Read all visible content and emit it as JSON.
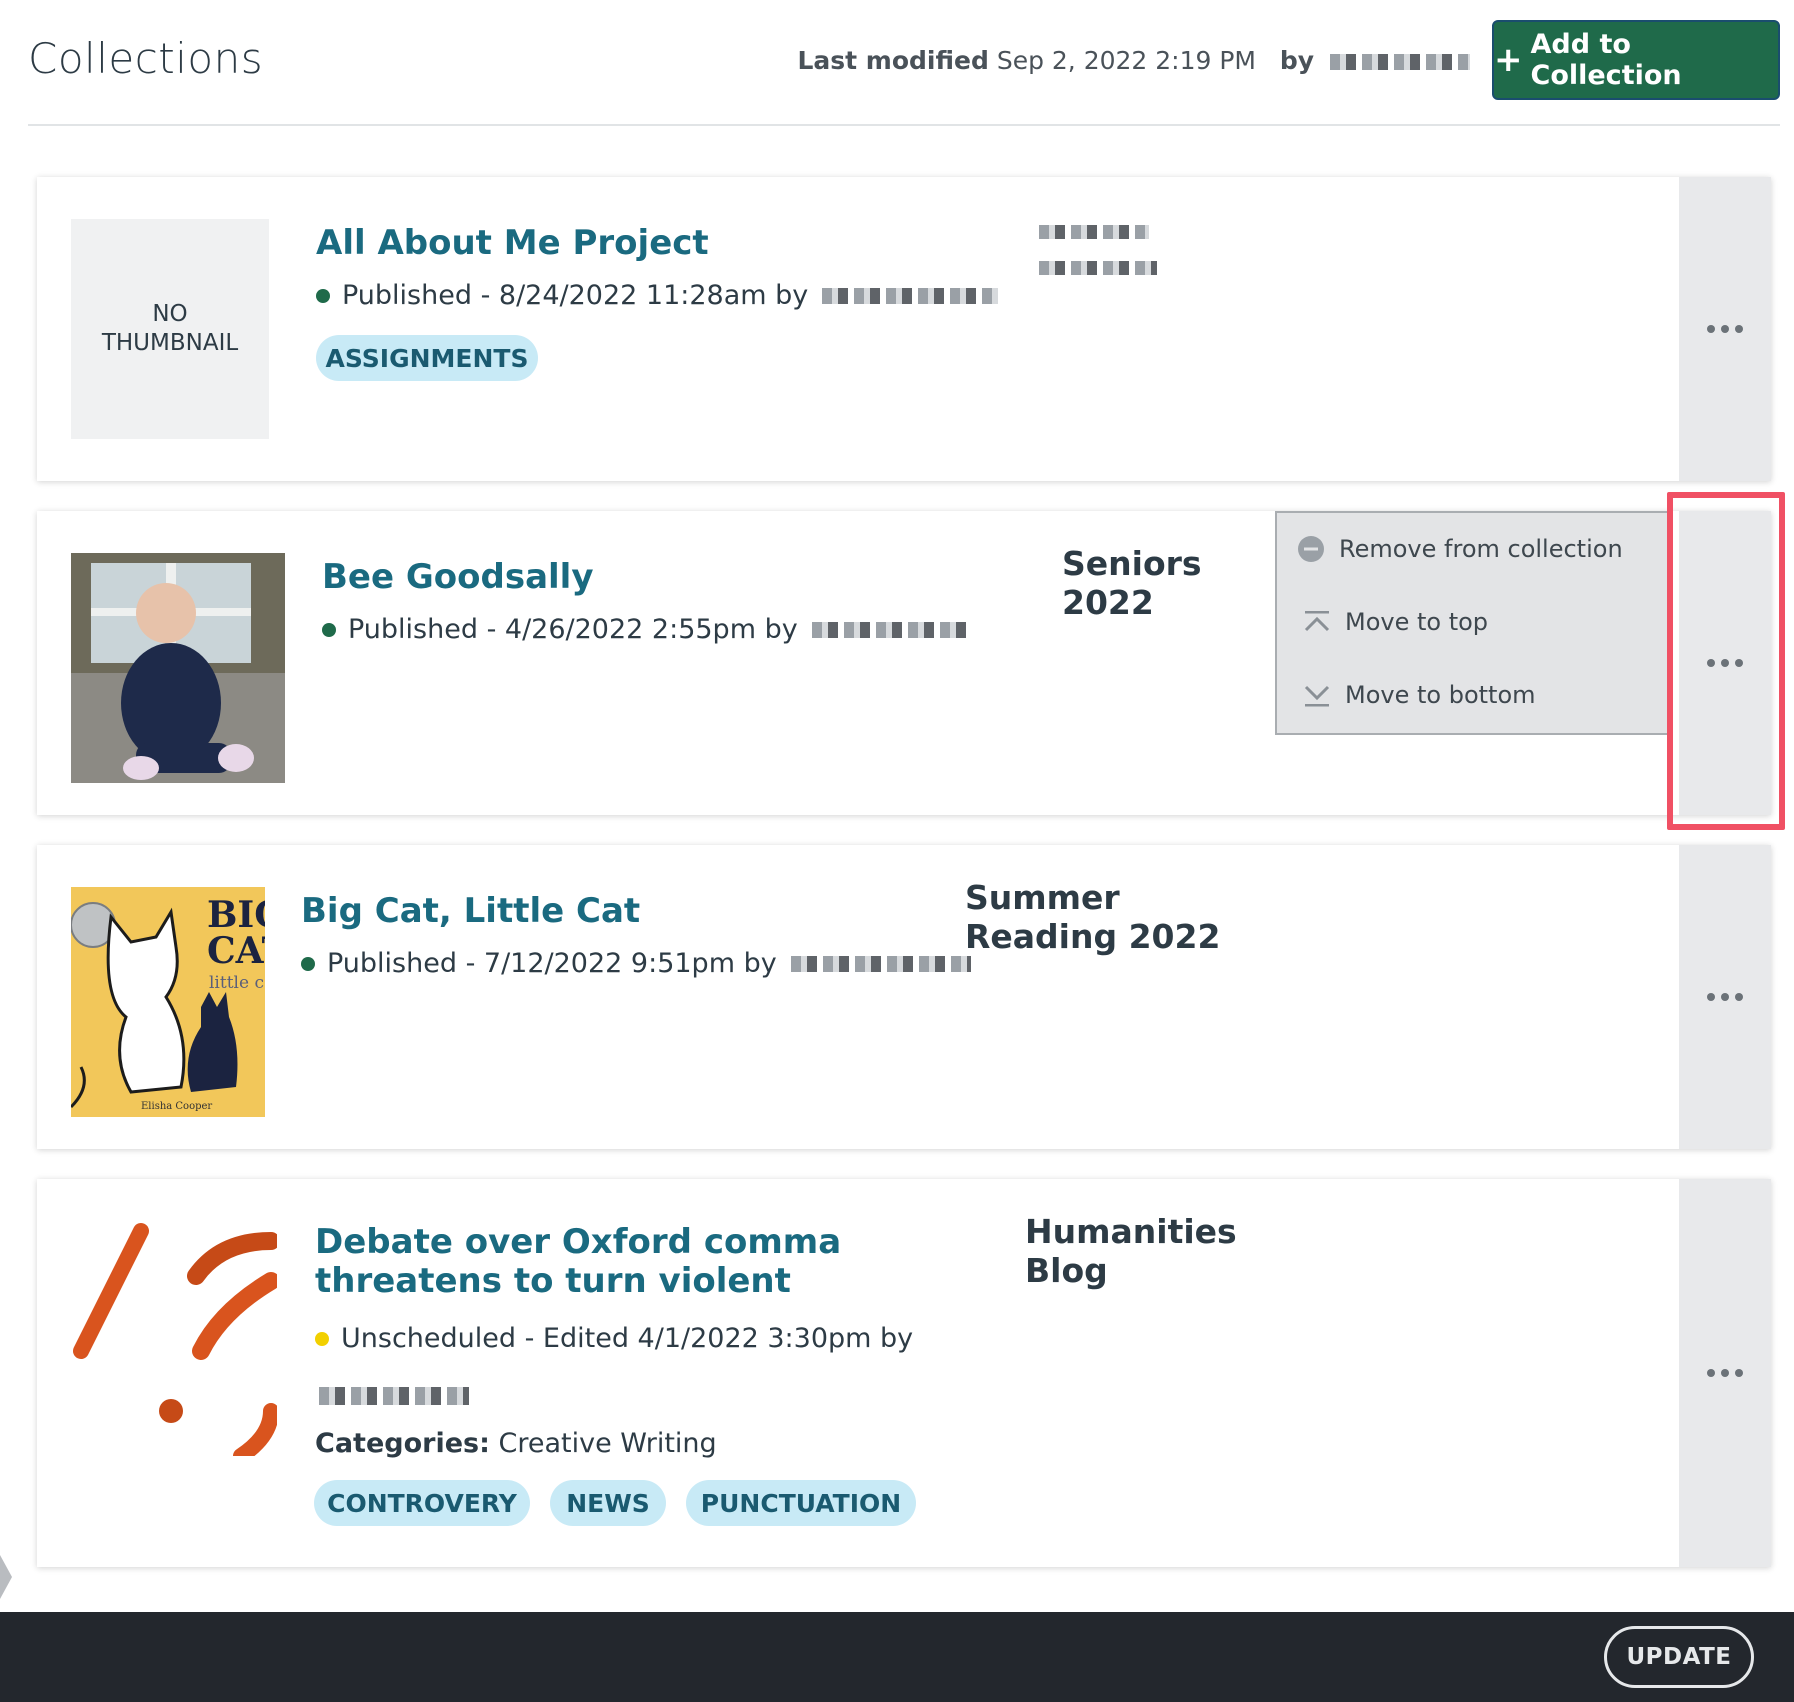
{
  "header": {
    "title": "Collections",
    "last_modified_label": "Last modified",
    "last_modified_value": "Sep 2, 2022 2:19 PM",
    "by_label": "by",
    "add_button_label": "Add to Collection"
  },
  "items": [
    {
      "thumbnail_text": "NO THUMBNAIL",
      "title": "All About Me Project",
      "status_color": "#1f6a4a",
      "status_text": "Published -  8/24/2022 11:28am  by",
      "tags": [
        "ASSIGNMENTS"
      ]
    },
    {
      "thumbnail": "baby-photo",
      "title": "Bee Goodsally",
      "status_color": "#1f6a4a",
      "status_text": "Published -  4/26/2022 2:55pm  by",
      "collection": "Seniors 2022"
    },
    {
      "thumbnail": "book-cover",
      "title": "Big Cat, Little Cat",
      "status_color": "#1f6a4a",
      "status_text": "Published -  7/12/2022 9:51pm  by",
      "collection": "Summer Reading 2022",
      "cover_title_1": "BIG",
      "cover_title_2": "CAT",
      "cover_subtitle": "little c",
      "cover_author": "Elisha Cooper"
    },
    {
      "thumbnail": "punctuation-art",
      "title": "Debate over Oxford comma threatens to turn violent",
      "status_color": "#f2d000",
      "status_text": "Unscheduled - Edited  4/1/2022 3:30pm  by",
      "collection": "Humanities Blog",
      "categories_label": "Categories:",
      "categories_value": "Creative Writing",
      "tags": [
        "CONTROVERY",
        "NEWS",
        "PUNCTUATION"
      ]
    }
  ],
  "dropdown": {
    "items": [
      {
        "label": "Remove from collection",
        "icon": "remove-circle-icon"
      },
      {
        "label": "Move to top",
        "icon": "move-to-top-icon"
      },
      {
        "label": "Move to bottom",
        "icon": "move-to-bottom-icon"
      }
    ]
  },
  "footer": {
    "update_label": "UPDATE"
  },
  "colors": {
    "accent": "#1f6a4a",
    "link": "#1a6a80",
    "tag_bg": "#c8eaf6",
    "highlight": "#f05064"
  }
}
